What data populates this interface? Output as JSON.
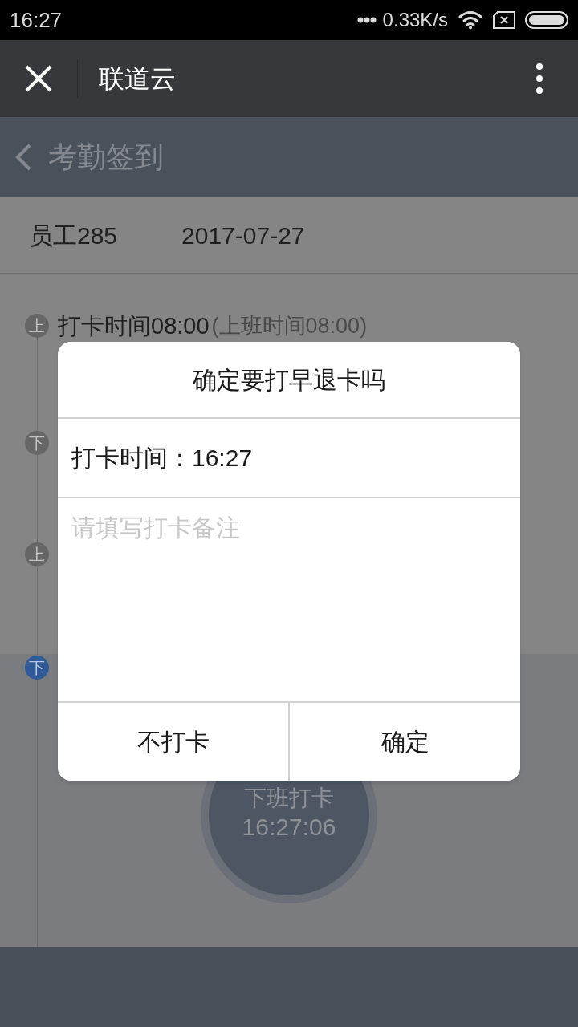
{
  "status_bar": {
    "time": "16:27",
    "speed": "0.33K/s"
  },
  "app_bar": {
    "title": "联道云"
  },
  "page_header": {
    "title": "考勤签到"
  },
  "info": {
    "employee": "员工285",
    "date": "2017-07-27"
  },
  "timeline": [
    {
      "marker": "上",
      "current": false,
      "time": "打卡时间08:00",
      "note": "(上班时间08:00)"
    },
    {
      "marker": "下",
      "current": false
    },
    {
      "marker": "上",
      "current": false
    },
    {
      "marker": "下",
      "current": true
    }
  ],
  "punch_button": {
    "label": "下班打卡",
    "time": "16:27:06"
  },
  "dialog": {
    "title": "确定要打早退卡吗",
    "time": "打卡时间：16:27",
    "remark_placeholder": "请填写打卡备注",
    "buttons": [
      "不打卡",
      "确定"
    ]
  }
}
